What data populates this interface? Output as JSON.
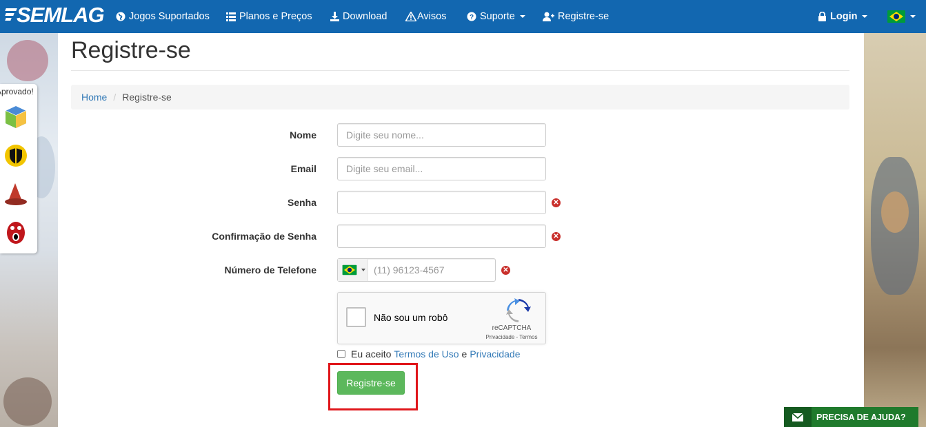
{
  "navbar": {
    "logo": "SEMLAG",
    "items": [
      {
        "label": "Jogos Suportados",
        "icon": "globe-icon"
      },
      {
        "label": "Planos e Preços",
        "icon": "list-icon"
      },
      {
        "label": "Download",
        "icon": "download-icon"
      },
      {
        "label": "Avisos",
        "icon": "warning-icon"
      },
      {
        "label": "Suporte",
        "icon": "question-icon"
      },
      {
        "label": "Registre-se",
        "icon": "user-plus-icon"
      }
    ],
    "login": "Login",
    "language_flag": "brazil-flag-icon"
  },
  "side": {
    "aprovado": "Aprovado!"
  },
  "page": {
    "title": "Registre-se",
    "breadcrumb": {
      "home": "Home",
      "current": "Registre-se"
    }
  },
  "form": {
    "name_label": "Nome",
    "name_placeholder": "Digite seu nome...",
    "email_label": "Email",
    "email_placeholder": "Digite seu email...",
    "password_label": "Senha",
    "password_confirm_label": "Confirmação de Senha",
    "phone_label": "Número de Telefone",
    "phone_placeholder": "(11) 96123-4567",
    "recaptcha": {
      "text": "Não sou um robô",
      "brand": "reCAPTCHA",
      "links": "Privacidade - Termos"
    },
    "terms": {
      "prefix": "Eu aceito",
      "terms_link": "Termos de Uso",
      "and": "e",
      "privacy_link": "Privacidade"
    },
    "submit_label": "Registre-se"
  },
  "help_button": "PRECISA DE AJUDA?",
  "colors": {
    "navbar": "#1267b0",
    "submit": "#5cb85c",
    "error": "#c9302c",
    "highlight": "#e0161b",
    "help": "#1f7a2c"
  }
}
